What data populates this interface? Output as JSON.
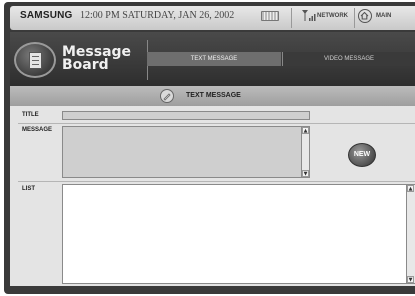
{
  "status_bar": {
    "brand": "SAMSUNG",
    "datetime": "12:00 PM SATURDAY, JAN 26, 2002",
    "network_label": "NETWORK",
    "home_label": "MAIN"
  },
  "app": {
    "title_line1": "Message",
    "title_line2": "Board"
  },
  "tabs": [
    {
      "label": "TEXT MESSAGE",
      "active": true
    },
    {
      "label": "VIDEO MESSAGE",
      "active": false
    }
  ],
  "section": {
    "title": "TEXT MESSAGE"
  },
  "form": {
    "title_label": "TITLE",
    "title_value": "",
    "message_label": "MESSAGE",
    "message_value": "",
    "new_button": "NEW",
    "list_label": "LIST"
  },
  "icons": {
    "battery": "battery-icon",
    "signal": "signal-icon",
    "home": "home-icon",
    "app": "document-icon",
    "section": "pen-icon"
  }
}
